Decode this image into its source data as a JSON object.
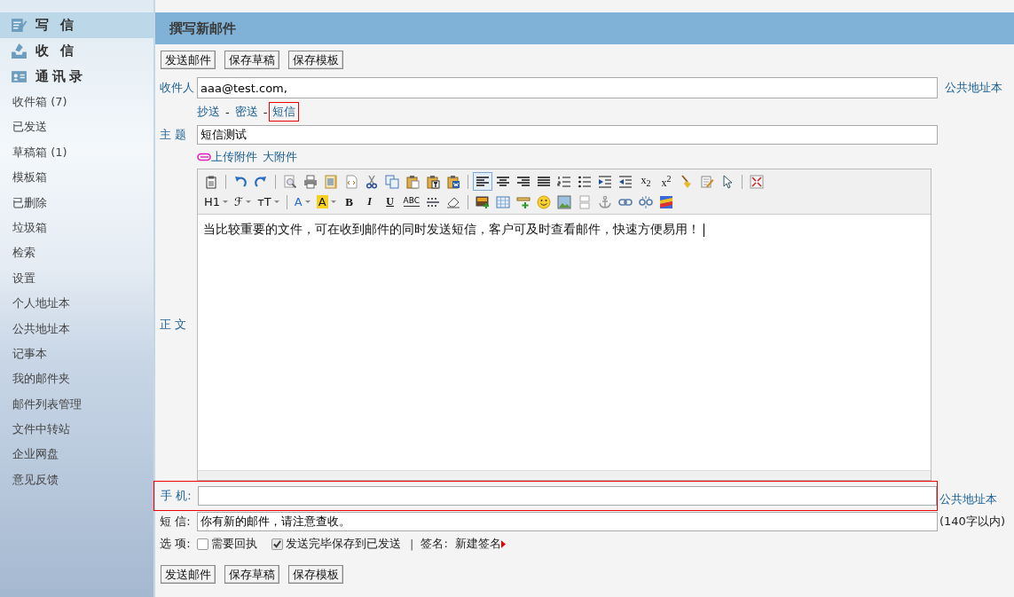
{
  "sidebar": {
    "main_items": [
      {
        "label": "写 信",
        "selected": true
      },
      {
        "label": "收 信",
        "selected": false
      },
      {
        "label": "通讯录",
        "selected": false
      }
    ],
    "folders": [
      {
        "label": "收件箱 (7)"
      },
      {
        "label": "已发送"
      },
      {
        "label": "草稿箱 (1)"
      },
      {
        "label": "模板箱"
      },
      {
        "label": "已删除"
      },
      {
        "label": "垃圾箱"
      },
      {
        "label": "检索"
      },
      {
        "label": "设置"
      },
      {
        "label": "个人地址本"
      },
      {
        "label": "公共地址本"
      },
      {
        "label": "记事本"
      },
      {
        "label": "我的邮件夹"
      },
      {
        "label": "邮件列表管理"
      },
      {
        "label": "文件中转站"
      },
      {
        "label": "企业网盘"
      },
      {
        "label": "意见反馈"
      }
    ]
  },
  "compose": {
    "title": "撰写新邮件",
    "top_buttons": [
      "发送邮件",
      "保存草稿",
      "保存模板"
    ],
    "to": {
      "label": "收件人",
      "value": "aaa@test.com,",
      "link": "公共地址本"
    },
    "extra_links": [
      {
        "label": "抄送",
        "highlighted": false
      },
      {
        "label": "密送",
        "highlighted": false
      },
      {
        "label": "短信",
        "highlighted": true
      }
    ],
    "link_separators": [
      "-",
      "-"
    ],
    "subject": {
      "label": "主 题",
      "value": "短信测试"
    },
    "attachments": [
      "上传附件",
      "大附件"
    ],
    "toolbar": [
      [
        {
          "kind": "icon",
          "selected": false
        },
        {
          "kind": "sep"
        },
        {
          "kind": "icon",
          "selected": false
        },
        {
          "kind": "icon",
          "selected": false
        },
        {
          "kind": "sep"
        },
        {
          "kind": "icon",
          "selected": false
        },
        {
          "kind": "icon",
          "selected": false
        },
        {
          "kind": "icon",
          "selected": false
        },
        {
          "kind": "icon",
          "selected": false
        },
        {
          "kind": "icon",
          "selected": false
        },
        {
          "kind": "icon",
          "selected": false
        },
        {
          "kind": "icon",
          "selected": false
        },
        {
          "kind": "icon",
          "selected": false
        },
        {
          "kind": "icon",
          "selected": false
        },
        {
          "kind": "sep"
        },
        {
          "kind": "icon",
          "selected": true
        },
        {
          "kind": "icon",
          "selected": false
        },
        {
          "kind": "icon",
          "selected": false
        },
        {
          "kind": "icon",
          "selected": false
        },
        {
          "kind": "icon",
          "selected": false
        },
        {
          "kind": "icon",
          "selected": false
        },
        {
          "kind": "icon",
          "selected": false
        },
        {
          "kind": "icon",
          "selected": false
        },
        {
          "kind": "text",
          "text": "x$_{2}$",
          "selected": false
        },
        {
          "kind": "text",
          "text": "x$^{2}$",
          "selected": false
        },
        {
          "kind": "icon",
          "selected": false
        },
        {
          "kind": "icon",
          "selected": false
        },
        {
          "kind": "icon",
          "selected": false
        },
        {
          "kind": "sep"
        },
        {
          "kind": "icon",
          "selected": false
        }
      ],
      [
        {
          "kind": "menu",
          "text": "H1",
          "selected": false
        },
        {
          "kind": "menu",
          "text": "ℱ",
          "selected": false
        },
        {
          "kind": "menu",
          "text": "ᴛT",
          "selected": false
        },
        {
          "kind": "sep"
        },
        {
          "kind": "colormenu",
          "text": "A",
          "selected": false
        },
        {
          "kind": "highlightmenu",
          "text": "A",
          "selected": false
        },
        {
          "kind": "bold",
          "text": "B",
          "selected": false
        },
        {
          "kind": "italic",
          "text": "I",
          "selected": false
        },
        {
          "kind": "underline",
          "text": "U",
          "selected": false
        },
        {
          "kind": "strike",
          "text": "ABC",
          "selected": false
        },
        {
          "kind": "icon",
          "selected": false
        },
        {
          "kind": "icon",
          "selected": false
        },
        {
          "kind": "sep"
        },
        {
          "kind": "icon",
          "selected": false
        },
        {
          "kind": "icon",
          "selected": false
        },
        {
          "kind": "icon",
          "selected": false
        },
        {
          "kind": "icon",
          "selected": false
        },
        {
          "kind": "icon",
          "selected": false
        },
        {
          "kind": "icon",
          "selected": false
        },
        {
          "kind": "icon",
          "selected": false
        },
        {
          "kind": "icon",
          "selected": false
        },
        {
          "kind": "icon",
          "selected": false
        },
        {
          "kind": "icon",
          "selected": false
        }
      ]
    ],
    "body": {
      "label": "正 文",
      "text": "当比较重要的文件，可在收到邮件的同时发送短信，客户可及时查看邮件，快速方便易用！"
    },
    "phone": {
      "label": "手 机:",
      "link": "公共地址本",
      "highlighted": true
    },
    "sms": {
      "label": "短 信:",
      "value": "你有新的邮件，请注意查收。",
      "note": "(140字以内)"
    },
    "options": {
      "label": "选 项:",
      "checkboxes": [
        {
          "label": "需要回执",
          "checked": false
        },
        {
          "label": "发送完毕保存到已发送",
          "checked": true
        }
      ],
      "separator": "|",
      "signature_label": "签名:",
      "signature": "新建签名"
    },
    "bottom_buttons": [
      "发送邮件",
      "保存草稿",
      "保存模板"
    ]
  }
}
